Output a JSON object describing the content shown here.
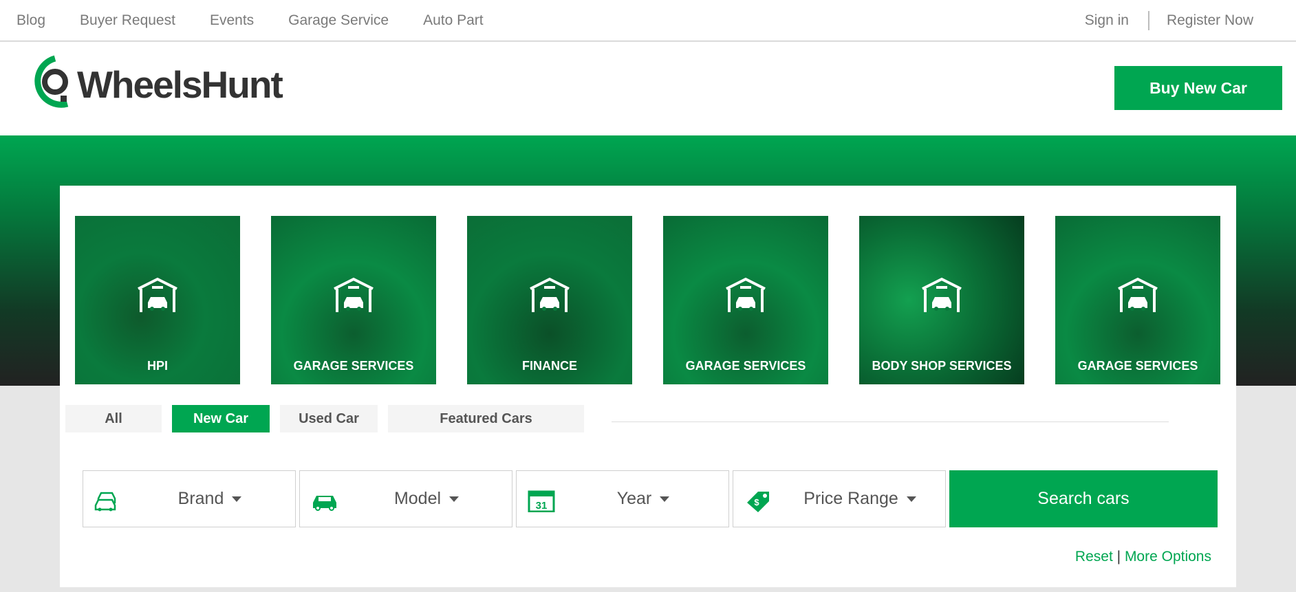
{
  "topnav": {
    "items": [
      "Blog",
      "Buyer Request",
      "Events",
      "Garage Service",
      "Auto Part"
    ],
    "sign_in": "Sign in",
    "register": "Register Now"
  },
  "header": {
    "logo_text": "WheelsHunt",
    "buy_button": "Buy New Car"
  },
  "tiles": [
    {
      "label": "HPI",
      "icon": "garage-car-icon"
    },
    {
      "label": "GARAGE SERVICES",
      "icon": "garage-car-icon"
    },
    {
      "label": "FINANCE",
      "icon": "garage-car-icon"
    },
    {
      "label": "GARAGE SERVICES",
      "icon": "garage-car-icon"
    },
    {
      "label": "BODY SHOP SERVICES",
      "icon": "garage-car-icon"
    },
    {
      "label": "GARAGE SERVICES",
      "icon": "garage-car-icon"
    }
  ],
  "tabs": [
    {
      "label": "All",
      "active": false
    },
    {
      "label": "New Car",
      "active": true
    },
    {
      "label": "Used Car",
      "active": false
    },
    {
      "label": "Featured Cars",
      "active": false
    }
  ],
  "filters": [
    {
      "label": "Brand",
      "icon": "cars-icon"
    },
    {
      "label": "Model",
      "icon": "car-icon"
    },
    {
      "label": "Year",
      "icon": "calendar-icon",
      "icon_text": "31"
    },
    {
      "label": "Price Range",
      "icon": "price-tag-icon"
    }
  ],
  "search_button": "Search cars",
  "links": {
    "reset": "Reset",
    "separator": "|",
    "more": "More Options"
  },
  "colors": {
    "accent": "#00a651",
    "text": "#555555"
  }
}
